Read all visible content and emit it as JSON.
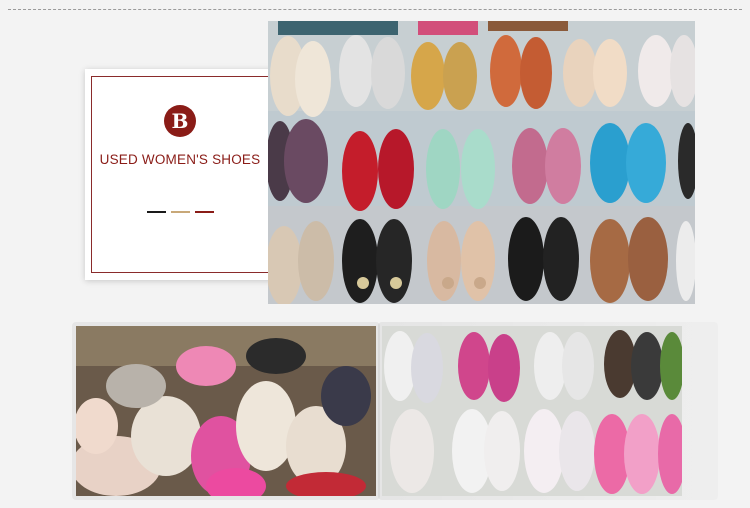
{
  "label": {
    "badge_letter": "B",
    "title": "USED WOMEN'S SHOES",
    "accent_color": "#8a1c17",
    "divider_colors": [
      "#1a1a1a",
      "#c8a878",
      "#8a1c17"
    ]
  },
  "photos": [
    {
      "name": "rows-of-womens-flats-and-sneakers"
    },
    {
      "name": "heap-of-mixed-shoes"
    },
    {
      "name": "rows-of-canvas-and-athletic-sneakers"
    }
  ]
}
